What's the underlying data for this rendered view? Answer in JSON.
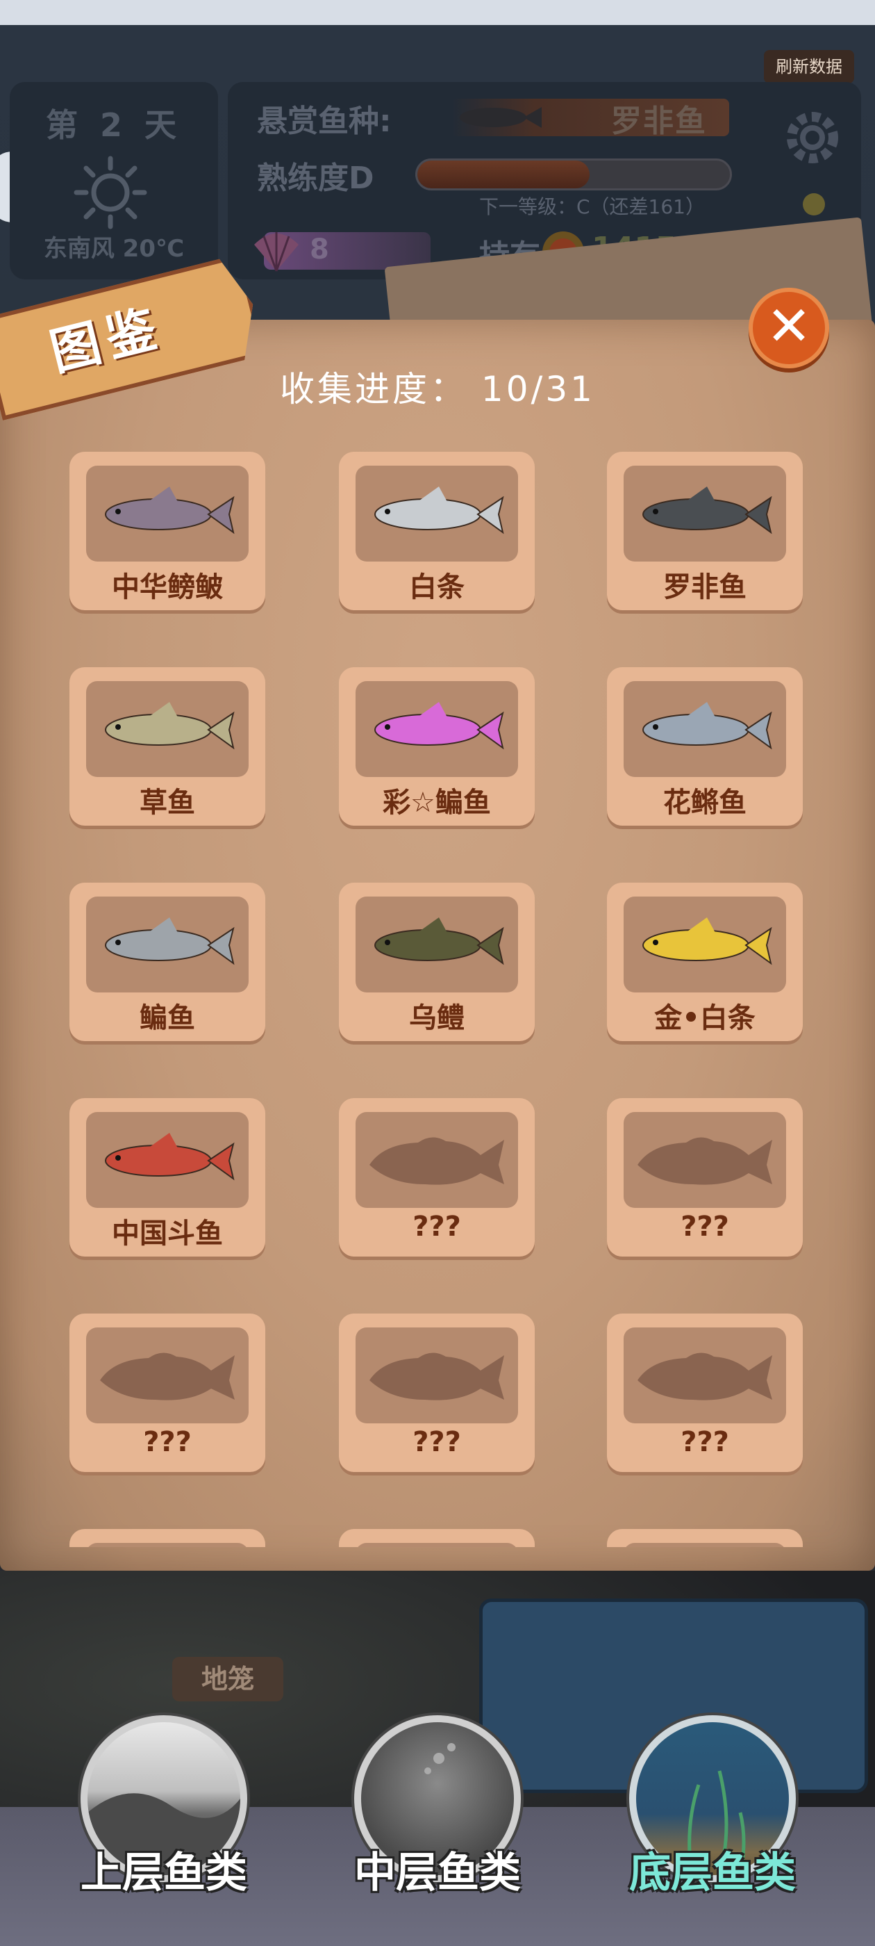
{
  "header": {
    "refresh_label": "刷新数据",
    "day": "第 2 天",
    "weather_icon": "sun-icon",
    "wind": "东南风 20℃",
    "bounty_label": "悬赏鱼种:",
    "bounty_fish": "罗非鱼",
    "proficiency_label": "熟练度D",
    "proficiency_progress": 0.55,
    "next_level": "下一等级：C（还差161）",
    "gems": "8",
    "own_label": "持有",
    "coins": "14158"
  },
  "codex": {
    "title": "图鉴",
    "progress": "收集进度： 10/31",
    "close_icon": "close-icon",
    "cards": [
      {
        "name": "中华鳑鲏",
        "color": "#8a7a8e"
      },
      {
        "name": "白条",
        "color": "#c8ccd0"
      },
      {
        "name": "罗非鱼",
        "color": "#4a4e52"
      },
      {
        "name": "草鱼",
        "color": "#b8b08a"
      },
      {
        "name": "彩☆鳊鱼",
        "color": "#d86ad8"
      },
      {
        "name": "花鳉鱼",
        "color": "#9aa6b4"
      },
      {
        "name": "鳊鱼",
        "color": "#9ea4aa"
      },
      {
        "name": "乌鳢",
        "color": "#5a5a38"
      },
      {
        "name": "金•白条",
        "color": "#e8c43a"
      },
      {
        "name": "中国斗鱼",
        "color": "#c84a3a"
      },
      {
        "name": "???",
        "color": "#8a6450"
      },
      {
        "name": "???",
        "color": "#8a6450"
      },
      {
        "name": "???",
        "color": "#8a6450"
      },
      {
        "name": "???",
        "color": "#8a6450"
      },
      {
        "name": "???",
        "color": "#8a6450"
      },
      {
        "name": "",
        "color": "#8a6450"
      },
      {
        "name": "",
        "color": "#8a6450"
      },
      {
        "name": "",
        "color": "#8a6450"
      }
    ]
  },
  "scene": {
    "ground_label": "地笼"
  },
  "tabs": [
    {
      "label": "上层鱼类",
      "icon": "upper-water-icon",
      "active": false
    },
    {
      "label": "中层鱼类",
      "icon": "middle-water-icon",
      "active": false
    },
    {
      "label": "底层鱼类",
      "icon": "bottom-water-icon",
      "active": true
    }
  ]
}
